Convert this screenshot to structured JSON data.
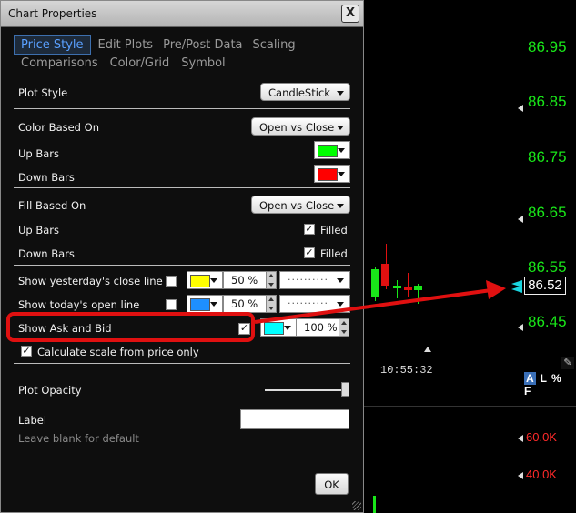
{
  "chart": {
    "price_labels": [
      "86.95",
      "86.85",
      "86.75",
      "86.65",
      "86.55",
      "86.45"
    ],
    "current_price": "86.52",
    "time_label": "10:55:32",
    "scale_buttons": [
      "A",
      "L",
      "%",
      "F"
    ],
    "volume_labels": [
      "60.0K",
      "40.0K"
    ],
    "colors": {
      "price_text": "#19e619",
      "volume_text": "#ff2a2a",
      "bid_ask_marker": "#19d5e0",
      "up_candle": "#19e619",
      "down_candle": "#e01010"
    }
  },
  "dialog": {
    "title": "Chart Properties",
    "close_label": "X",
    "tabs_row1": [
      "Price Style",
      "Edit Plots",
      "Pre/Post Data",
      "Scaling"
    ],
    "tabs_row2": [
      "Comparisons",
      "Color/Grid",
      "Symbol"
    ],
    "active_tab": "Price Style",
    "plot_style": {
      "label": "Plot Style",
      "value": "CandleStick"
    },
    "color_based_on": {
      "label": "Color Based On",
      "value": "Open vs Close"
    },
    "up_bars": {
      "label": "Up Bars",
      "color": "#00ff00"
    },
    "down_bars": {
      "label": "Down Bars",
      "color": "#ff0000"
    },
    "fill_based_on": {
      "label": "Fill Based On",
      "value": "Open vs Close"
    },
    "fill_up_bars": {
      "label": "Up Bars",
      "filled_label": "Filled",
      "checked": true
    },
    "fill_down_bars": {
      "label": "Down Bars",
      "filled_label": "Filled",
      "checked": true
    },
    "yesterday_close": {
      "label": "Show yesterday's close line",
      "checked": false,
      "color": "#ffff00",
      "opacity": "50 %",
      "line_style": "··········"
    },
    "today_open": {
      "label": "Show today's open line",
      "checked": false,
      "color": "#1e8fff",
      "opacity": "50 %",
      "line_style": "··········"
    },
    "ask_bid": {
      "label": "Show Ask and Bid",
      "checked": true,
      "color": "#00ffff",
      "opacity": "100 %"
    },
    "calc_scale": {
      "label": "Calculate scale from price only",
      "checked": true
    },
    "plot_opacity": {
      "label": "Plot Opacity",
      "value": 1.0
    },
    "label_field": {
      "label": "Label",
      "value": "",
      "hint": "Leave blank for default"
    },
    "ok_label": "OK"
  }
}
